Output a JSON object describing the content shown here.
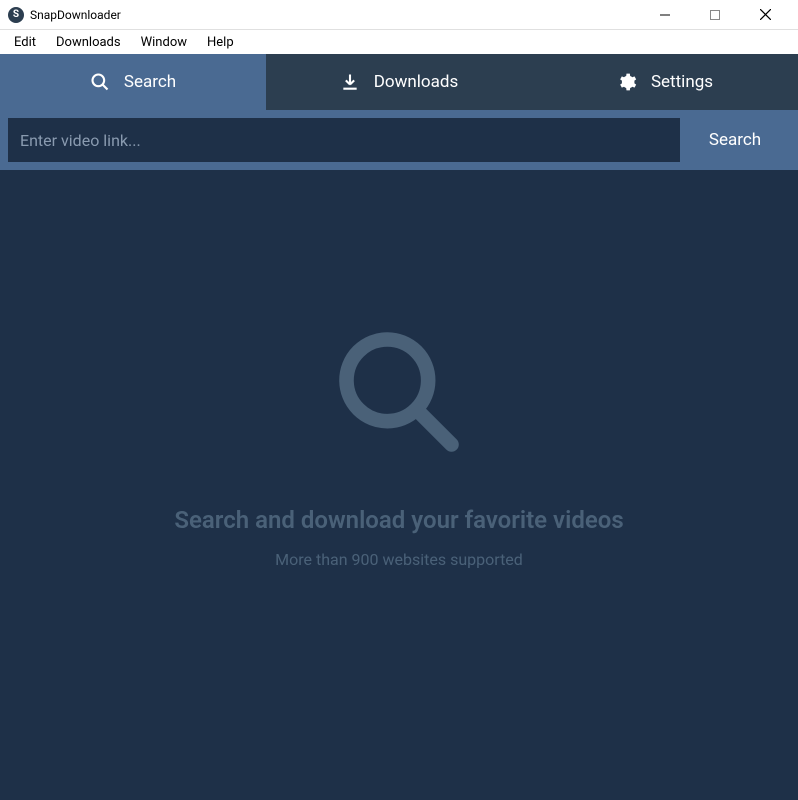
{
  "window": {
    "title": "SnapDownloader"
  },
  "menubar": {
    "items": [
      "Edit",
      "Downloads",
      "Window",
      "Help"
    ]
  },
  "tabs": {
    "search": "Search",
    "downloads": "Downloads",
    "settings": "Settings"
  },
  "search": {
    "placeholder": "Enter video link...",
    "button": "Search"
  },
  "empty_state": {
    "headline": "Search and download your favorite videos",
    "subtext": "More than 900 websites supported"
  }
}
